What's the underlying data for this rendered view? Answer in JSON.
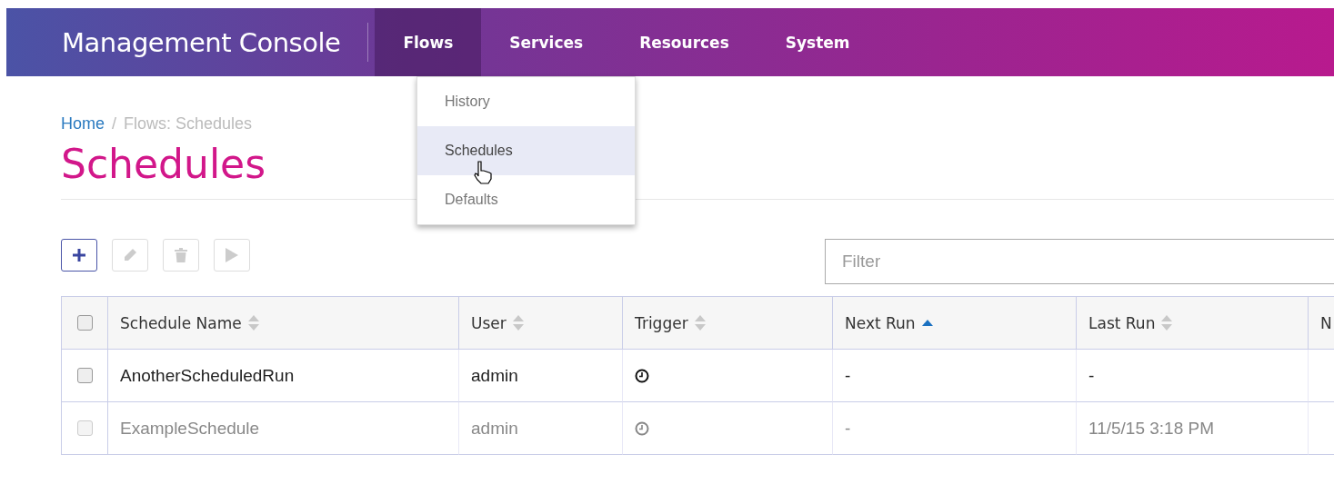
{
  "app": {
    "title": "Management Console"
  },
  "nav": [
    {
      "label": "Flows",
      "selected": true
    },
    {
      "label": "Services",
      "selected": false
    },
    {
      "label": "Resources",
      "selected": false
    },
    {
      "label": "System",
      "selected": false
    }
  ],
  "dropdown": [
    {
      "label": "History",
      "selected": false
    },
    {
      "label": "Schedules",
      "selected": true
    },
    {
      "label": "Defaults",
      "selected": false
    }
  ],
  "breadcrumb": {
    "home": "Home",
    "separator": "/",
    "current": "Flows: Schedules"
  },
  "page_title": "Schedules",
  "toolbar": [
    {
      "kind": "add",
      "disabled": false
    },
    {
      "kind": "edit",
      "disabled": true
    },
    {
      "kind": "delete",
      "disabled": true
    },
    {
      "kind": "run",
      "disabled": true
    }
  ],
  "filter": {
    "placeholder": "Filter"
  },
  "table": {
    "header_checked": false,
    "columns": [
      {
        "label": "Schedule Name",
        "sorted": false
      },
      {
        "label": "User",
        "sorted": false
      },
      {
        "label": "Trigger",
        "sorted": false
      },
      {
        "label": "Next Run",
        "sorted": true
      },
      {
        "label": "Last Run",
        "sorted": false
      },
      {
        "label": "N"
      }
    ],
    "rows": [
      {
        "name": "AnotherScheduledRun",
        "user": "admin",
        "next_run": "-",
        "last_run": "-",
        "enabled": true,
        "checked": false
      },
      {
        "name": "ExampleSchedule",
        "user": "admin",
        "next_run": "-",
        "last_run": "11/5/15 3:18 PM",
        "enabled": false,
        "checked": false
      }
    ]
  }
}
